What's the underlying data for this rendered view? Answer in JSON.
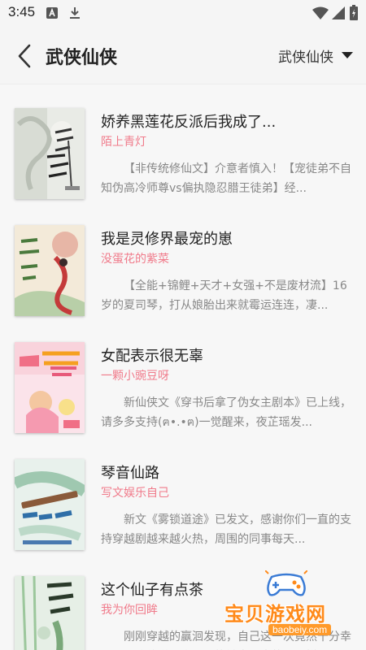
{
  "status_bar": {
    "time": "3:45",
    "icons": [
      "a-badge-icon",
      "download-icon",
      "wifi-icon",
      "signal-icon",
      "battery-icon"
    ]
  },
  "header": {
    "title": "武侠仙侠",
    "category_selected": "武侠仙侠"
  },
  "books": [
    {
      "title": "娇养黑莲花反派后我成了...",
      "author": "陌上青灯",
      "description": "【非传统修仙文】介意者慎入！【宠徒弟不自知伪高冷师尊vs偏执隐忍腊王徒弟】经..."
    },
    {
      "title": "我是灵修界最宠的崽",
      "author": "没蛋花的紫菜",
      "description": "【全能+锦鲤+天才+女强+不是废材流】16岁的夏司琴，打从娘胎出来就霉运连连，凄..."
    },
    {
      "title": "女配表示很无辜",
      "author": "一颗小豌豆呀",
      "description": "新仙侠文《穿书后拿了伪女主剧本》已上线，请多多支持(ฅ•.•ฅ)一觉醒来，夜芷瑶发..."
    },
    {
      "title": "琴音仙路",
      "author": "写文娱乐自己",
      "description": "新文《雾锁道途》已发文，感谢你们一直的支持穿越剧越来越火热，周围的同事每天..."
    },
    {
      "title": "这个仙子有点茶",
      "author": "我为你回眸",
      "description": "刚刚穿越的赢洄发现，自己这一次竟然十分幸运。不致传说，竟还是能够容回来的，同样..."
    }
  ],
  "watermark": {
    "text": "宝贝游戏网",
    "url": "baobeiy.com"
  },
  "colors": {
    "accent_author": "#f07a8a",
    "watermark": "#ff8a1a"
  }
}
